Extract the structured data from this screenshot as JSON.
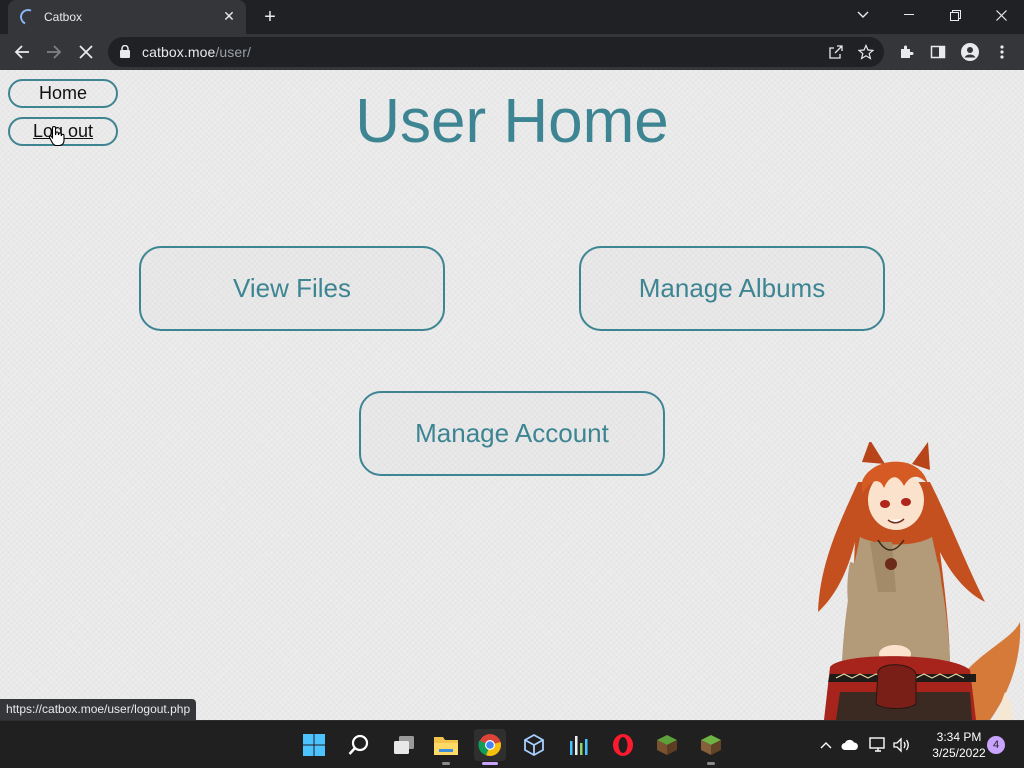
{
  "browser": {
    "tab_title": "Catbox",
    "url_host": "catbox.moe",
    "url_path": "/user/",
    "status_url": "https://catbox.moe/user/logout.php"
  },
  "page": {
    "nav": {
      "home": "Home",
      "logout": "Log out"
    },
    "title": "User Home",
    "buttons": {
      "view_files": "View Files",
      "manage_albums": "Manage Albums",
      "manage_account": "Manage Account"
    }
  },
  "taskbar": {
    "time": "3:34 PM",
    "date": "3/25/2022",
    "notification_count": "4"
  },
  "colors": {
    "accent": "#3d8593",
    "page_background": "#ececec",
    "browser_frame": "#202124"
  }
}
